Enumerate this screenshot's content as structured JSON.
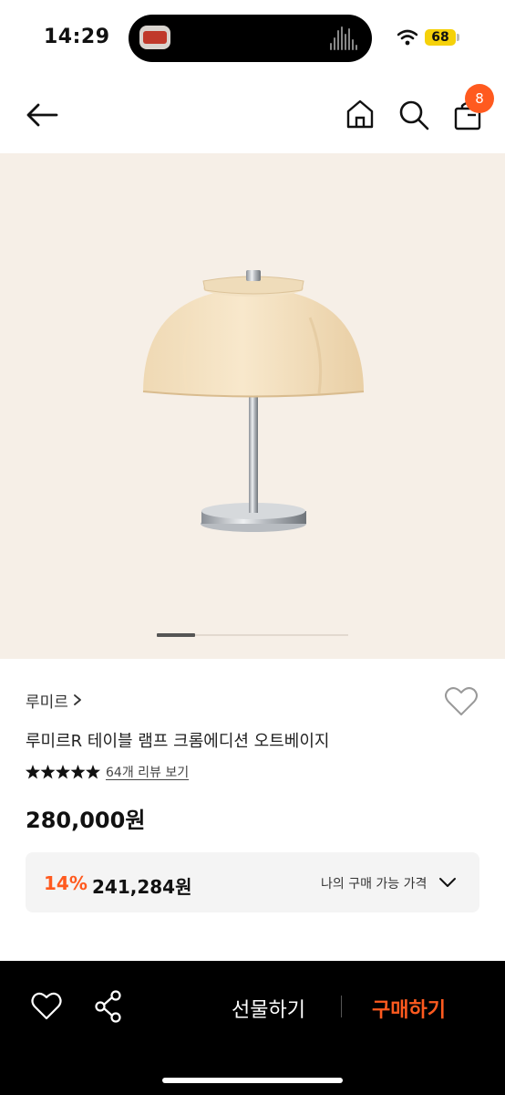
{
  "status_bar": {
    "time": "14:29",
    "battery": "68"
  },
  "nav": {
    "cart_count": "8"
  },
  "gallery": {
    "image_alt": "table lamp product photo",
    "current_index": 1,
    "image_count": 5
  },
  "product": {
    "brand": "루미르",
    "title": "루미르R 테이블 램프 크롬에디션 오트베이지",
    "rating_stars": 5,
    "review_link": "64개 리뷰 보기",
    "price": "280,000원"
  },
  "my_price": {
    "discount": "14%",
    "price": "241,284원",
    "label": "나의 구매 가능 가격"
  },
  "bottom_bar": {
    "gift_label": "선물하기",
    "buy_label": "구매하기"
  },
  "colors": {
    "accent": "#ff5a1f",
    "hero_bg": "#f6efe7",
    "bottom_bar": "#000000",
    "battery": "#f5d10a"
  }
}
